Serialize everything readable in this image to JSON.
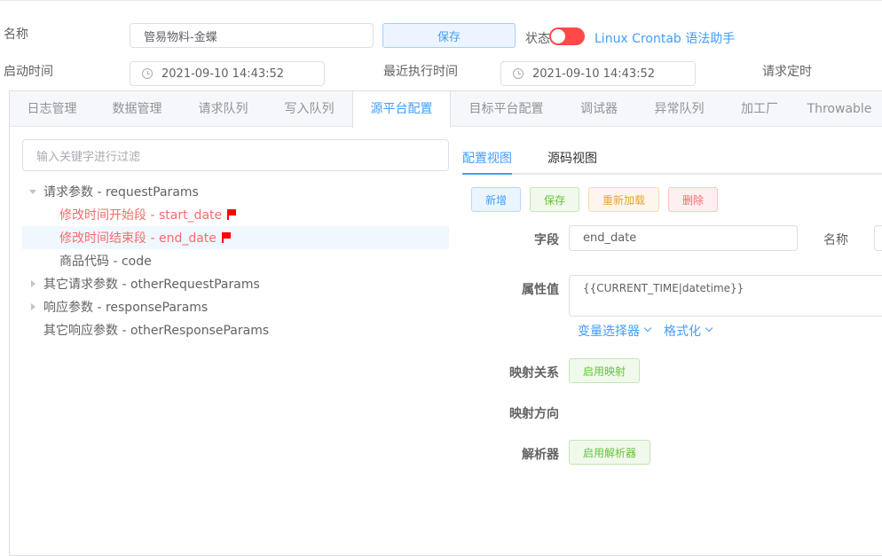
{
  "header": {
    "name_label": "名称",
    "name_value": "管易物料-金蝶",
    "save_label": "保存",
    "status_label": "状态",
    "crontab_link": "Linux Crontab 语法助手",
    "start_label": "启动时间",
    "start_value": "2021-09-10 14:43:52",
    "last_exec_label": "最近执行时间",
    "last_exec_value": "2021-09-10 14:43:52",
    "schedule_label": "请求定时"
  },
  "tabs": [
    "日志管理",
    "数据管理",
    "请求队列",
    "写入队列",
    "源平台配置",
    "目标平台配置",
    "调试器",
    "异常队列",
    "加工厂",
    "Throwable"
  ],
  "filter": {
    "placeholder": "输入关键字进行过滤"
  },
  "tree": [
    "请求参数 - requestParams",
    "修改时间开始段 - start_date",
    "修改时间结束段 - end_date",
    "商品代码 - code",
    "其它请求参数 - otherRequestParams",
    "响应参数 - responseParams",
    "其它响应参数 - otherResponseParams"
  ],
  "subtabs": {
    "config_view": "配置视图",
    "source_view": "源码视图"
  },
  "actions": {
    "add": "新增",
    "save": "保存",
    "reload": "重新加载",
    "delete": "删除"
  },
  "form": {
    "field_label": "字段",
    "field_value": "end_date",
    "name_label": "名称",
    "attr_label": "属性值",
    "attr_value": "{{CURRENT_TIME|datetime}}",
    "var_selector": "变量选择器",
    "format": "格式化",
    "mapping_label": "映射关系",
    "mapping_button": "启用映射",
    "direction_label": "映射方向",
    "parser_label": "解析器",
    "parser_button": "启用解析器"
  },
  "colors": {
    "accent": "#409eff",
    "switch_off": "#ff4949",
    "danger": "#f56c6c"
  }
}
